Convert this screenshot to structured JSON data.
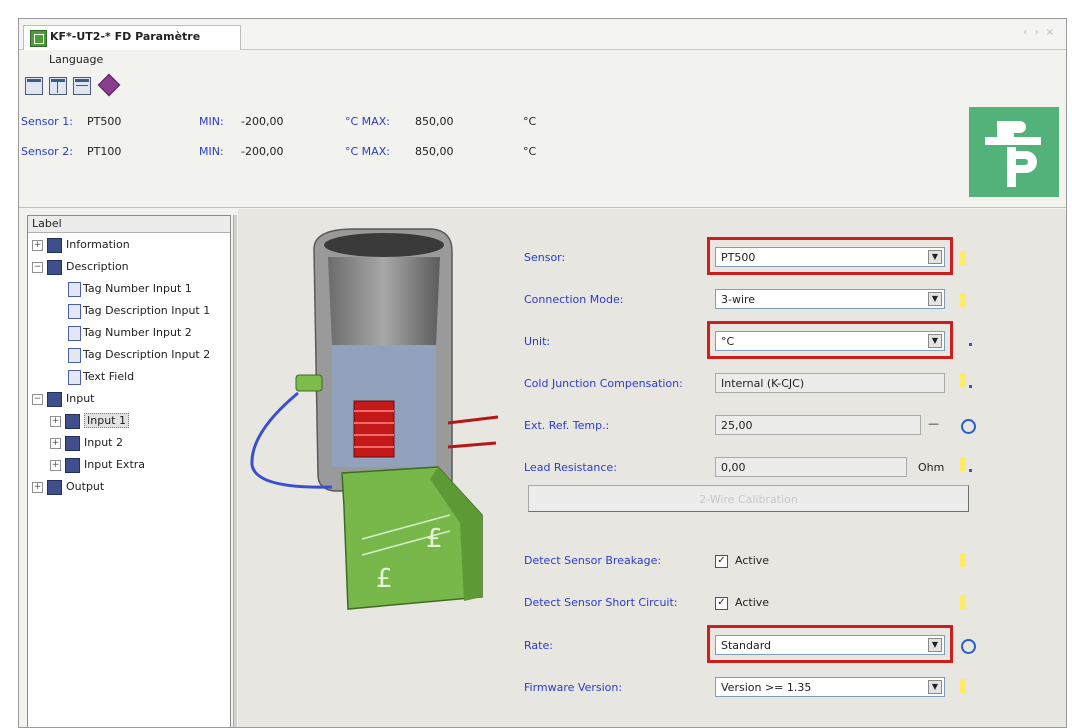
{
  "window": {
    "tab_title": "KF*-UT2-* FD Paramètre",
    "controls": "‹ › ×"
  },
  "menu": {
    "language": "Language"
  },
  "header": {
    "sensor1": {
      "label": "Sensor 1:",
      "type": "PT500",
      "min_label": "MIN:",
      "min": "-200,00",
      "unit_max_label": "°C MAX:",
      "max": "850,00",
      "unit": "°C"
    },
    "sensor2": {
      "label": "Sensor 2:",
      "type": "PT100",
      "min_label": "MIN:",
      "min": "-200,00",
      "unit_max_label": "°C MAX:",
      "max": "850,00",
      "unit": "°C"
    }
  },
  "tree": {
    "header": "Label",
    "items": [
      {
        "label": "Information",
        "expander": "+"
      },
      {
        "label": "Description",
        "expander": "−"
      },
      {
        "label": "Tag Number Input 1"
      },
      {
        "label": "Tag Description Input 1"
      },
      {
        "label": "Tag Number Input 2"
      },
      {
        "label": "Tag Description Input 2"
      },
      {
        "label": "Text Field"
      },
      {
        "label": "Input",
        "expander": "−"
      },
      {
        "label": "Input 1",
        "expander": "+"
      },
      {
        "label": "Input 2",
        "expander": "+"
      },
      {
        "label": "Input Extra",
        "expander": "+"
      },
      {
        "label": "Output",
        "expander": "+"
      }
    ]
  },
  "form": {
    "sensor": {
      "label": "Sensor:",
      "value": "PT500"
    },
    "connection_mode": {
      "label": "Connection Mode:",
      "value": "3-wire"
    },
    "unit": {
      "label": "Unit:",
      "value": "°C"
    },
    "cold_junction": {
      "label": "Cold Junction Compensation:",
      "value": "Internal (K-CJC)"
    },
    "ext_ref_temp": {
      "label": "Ext. Ref. Temp.:",
      "value": "25,00",
      "suffix": "—"
    },
    "lead_resistance": {
      "label": "Lead Resistance:",
      "value": "0,00",
      "unit": "Ohm"
    },
    "calibration_button": "2-Wire Calibration",
    "detect_breakage": {
      "label": "Detect Sensor Breakage:",
      "check_label": "Active",
      "check_mark": "✓"
    },
    "detect_short": {
      "label": "Detect Sensor Short Circuit:",
      "check_label": "Active",
      "check_mark": "✓"
    },
    "rate": {
      "label": "Rate:",
      "value": "Standard"
    },
    "firmware": {
      "label": "Firmware Version:",
      "value": "Version >= 1.35"
    },
    "dropdown_arrow": "▼"
  },
  "colors": {
    "label_blue": "#2a3cc8",
    "highlight_red": "#cc1e1e",
    "logo_green": "#52b27a"
  }
}
